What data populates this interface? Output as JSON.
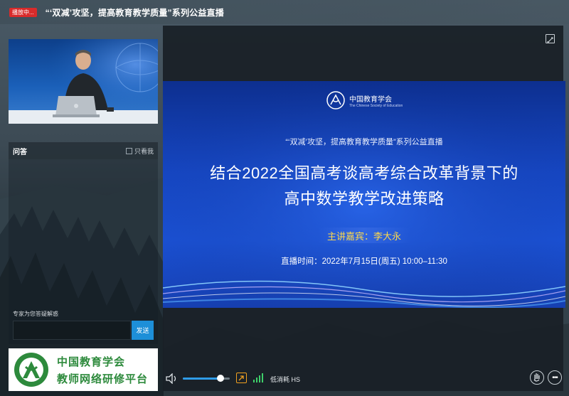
{
  "header": {
    "live_badge": "播放中...",
    "title": "“‘双减’攻坚，提高教育教学质量”系列公益直播"
  },
  "qa": {
    "title": "问答",
    "only_me_label": "只看我",
    "only_me_checked": false,
    "hint": "专家为您答疑解惑",
    "input_value": "",
    "send_label": "发送"
  },
  "platform_logo": {
    "line1": "中国教育学会",
    "line2": "教师网络研修平台",
    "color": "#2d8a3c"
  },
  "slide": {
    "org_name": "中国教育学会",
    "org_name_en": "The Chinese Society of Education",
    "series": "“‘双减’攻坚，提高教育教学质量”系列公益直播",
    "headline_line1": "结合2022全国高考谈高考综合改革背景下的",
    "headline_line2": "高中数学教学改进策略",
    "speaker": "主讲嘉宾：李大永",
    "time": "直播时间：2022年7月15日(周五) 10:00–11:30",
    "speaker_color": "#ffd94a"
  },
  "controls": {
    "volume": 0.8,
    "quality_label": "低消耗 HS",
    "accent": "#2f9ce8"
  }
}
